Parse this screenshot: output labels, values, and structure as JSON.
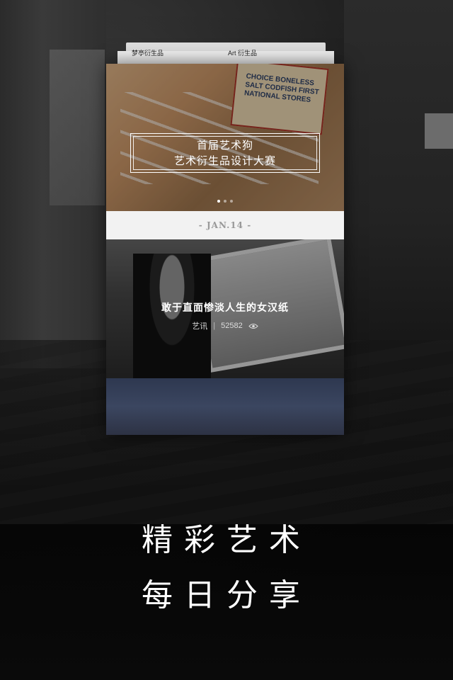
{
  "stack_tabs": [
    "梦亭衍生品",
    "Art 衍生品"
  ],
  "hero": {
    "title_line1": "首届艺术狗",
    "title_line2": "艺术衍生品设计大赛",
    "box_text": "CHOICE BONELESS SALT CODFISH FIRST NATIONAL STORES",
    "page_indicator": {
      "count": 3,
      "active": 0
    }
  },
  "date": "- JAN.14 -",
  "article": {
    "title": "敢于直面惨淡人生的女汉纸",
    "category": "艺讯",
    "separator": "|",
    "views": "52582",
    "views_icon": "eye-icon"
  },
  "slogan": {
    "line1": "精彩艺术",
    "line2": "每日分享"
  }
}
